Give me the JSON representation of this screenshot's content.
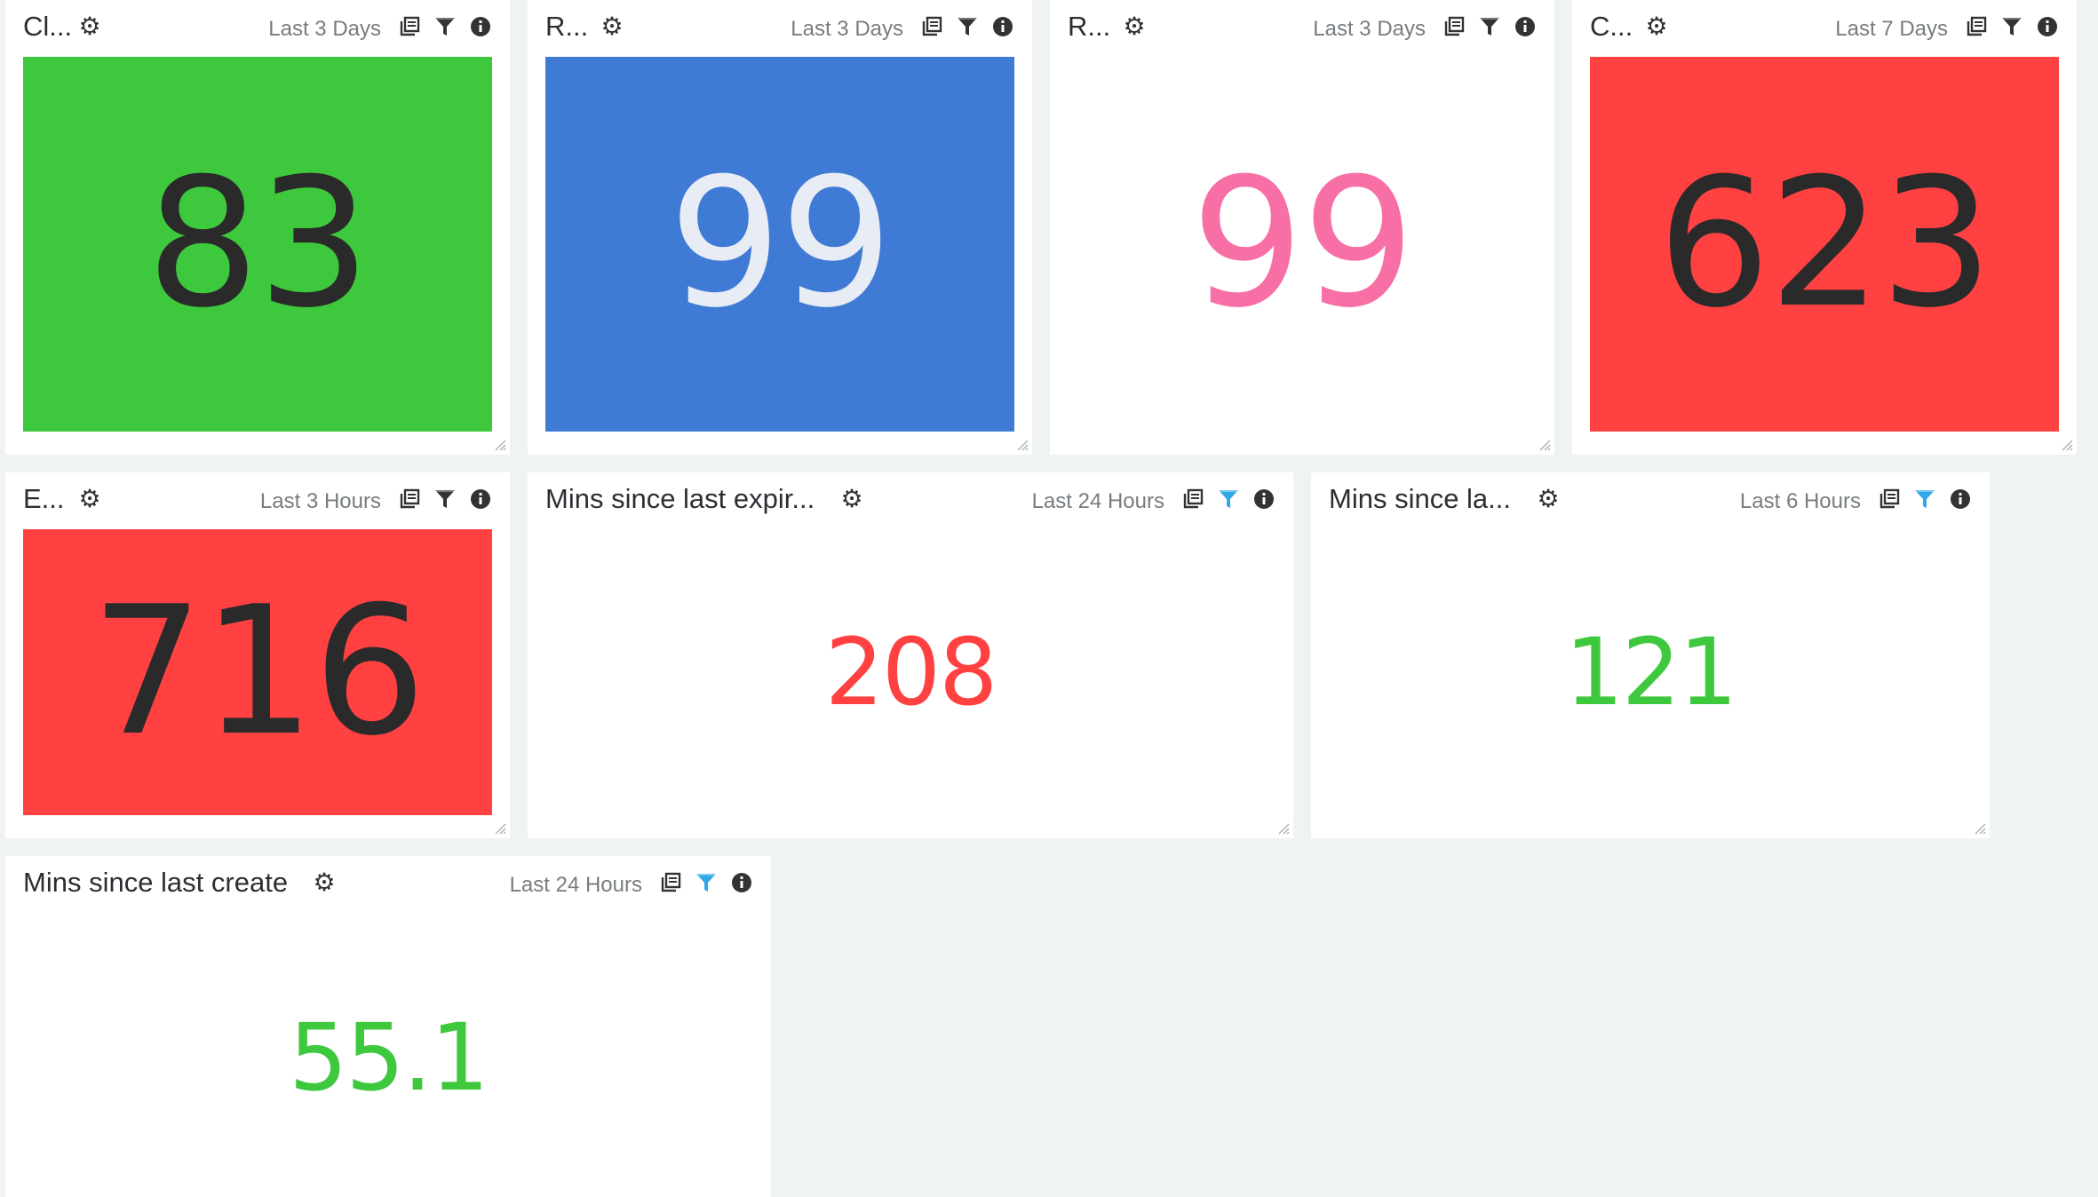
{
  "colors": {
    "green": "#3ec83d",
    "blue": "#3f7ad5",
    "red": "#ff4142",
    "pink": "#f86fa6",
    "dark_text": "#2b2a2a",
    "light_text": "#e8ecf4",
    "filter_active": "#2ea8e6",
    "background": "#eff3f4"
  },
  "icons": {
    "settings": "gear-icon",
    "copy": "copy-icon",
    "filter": "filter-icon",
    "info": "info-icon",
    "resize": "resize-handle-icon"
  },
  "widgets": [
    {
      "title": "Cl...",
      "range": "Last 3 Days",
      "value": "83",
      "tile": "green",
      "value_color": "dark_text",
      "filter_active": false
    },
    {
      "title": "R...",
      "range": "Last 3 Days",
      "value": "99",
      "tile": "blue",
      "value_color": "light_text",
      "filter_active": false
    },
    {
      "title": "R...",
      "range": "Last 3 Days",
      "value": "99",
      "tile": "none",
      "value_color": "pink",
      "filter_active": false
    },
    {
      "title": "C...",
      "range": "Last 7 Days",
      "value": "623",
      "tile": "red",
      "value_color": "dark_text",
      "filter_active": false
    },
    {
      "title": "E...",
      "range": "Last 3 Hours",
      "value": "716",
      "tile": "red",
      "value_color": "dark_text",
      "filter_active": false
    },
    {
      "title": "Mins since last expir...",
      "range": "Last 24 Hours",
      "value": "208",
      "tile": "none",
      "value_color": "red",
      "filter_active": true
    },
    {
      "title": "Mins since la...",
      "range": "Last 6 Hours",
      "value": "121",
      "tile": "none",
      "value_color": "green",
      "filter_active": true
    },
    {
      "title": "Mins since last create",
      "range": "Last 24 Hours",
      "value": "55.1",
      "tile": "none",
      "value_color": "green",
      "filter_active": true
    }
  ]
}
